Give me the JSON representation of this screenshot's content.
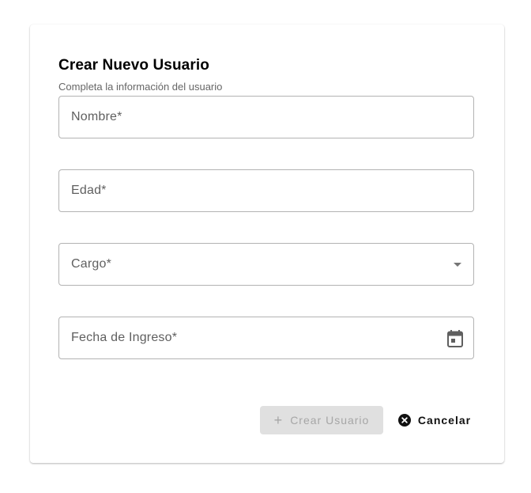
{
  "form": {
    "title": "Crear Nuevo Usuario",
    "subtitle": "Completa la información del usuario",
    "fields": {
      "nombre": {
        "label": "Nombre*",
        "value": ""
      },
      "edad": {
        "label": "Edad*",
        "value": ""
      },
      "cargo": {
        "label": "Cargo*",
        "selected": "",
        "icon": "chevron-down-icon"
      },
      "fecha": {
        "label": "Fecha de Ingreso*",
        "value": "",
        "icon": "calendar-icon"
      }
    },
    "actions": {
      "create_label": "Crear Usuario",
      "create_icon": "plus-icon",
      "create_disabled": true,
      "cancel_label": "Cancelar",
      "cancel_icon": "cancel-circle-icon"
    }
  },
  "colors": {
    "field_border": "#b3b3b3",
    "label_text": "#5f5f5f",
    "disabled_bg": "#e0e0e0",
    "disabled_text": "#a6a6a6",
    "cancel_text": "#111111"
  }
}
